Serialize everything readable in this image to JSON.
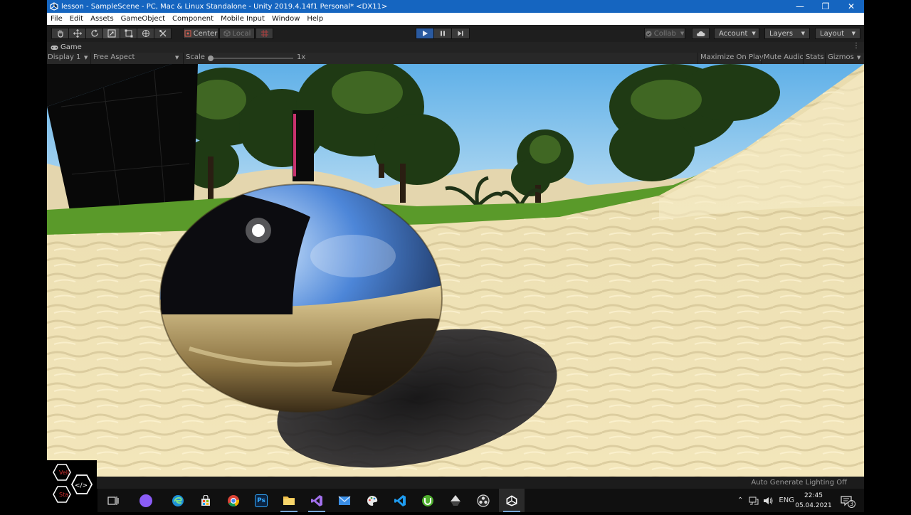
{
  "window": {
    "title": "lesson - SampleScene - PC, Mac & Linux Standalone - Unity 2019.4.14f1 Personal* <DX11>",
    "minimize": "—",
    "maximize": "❐",
    "close": "✕"
  },
  "menu": [
    "File",
    "Edit",
    "Assets",
    "GameObject",
    "Component",
    "Mobile Input",
    "Window",
    "Help"
  ],
  "toolbar": {
    "pivot_label": "Center",
    "space_label": "Local",
    "collab_label": "Collab",
    "account_label": "Account",
    "layers_label": "Layers",
    "layout_label": "Layout"
  },
  "game_tab": {
    "label": "Game",
    "more": "⋮"
  },
  "game_bar": {
    "display": "Display 1",
    "aspect": "Free Aspect",
    "scale_label": "Scale",
    "scale_value": "1x",
    "maximize_on_play": "Maximize On Play",
    "mute_audio": "Mute Audio",
    "stats": "Stats",
    "gizmos": "Gizmos"
  },
  "status": {
    "text": "Auto Generate Lighting Off"
  },
  "taskbar": {
    "lang": "ENG",
    "time": "22:45",
    "date": "05.04.2021",
    "notifications": "3"
  },
  "icon_labels": {
    "photoshop": "Ps"
  },
  "logo": {
    "text_top": "Veli",
    "text_bottom": "Sta"
  },
  "colors": {
    "title_bar": "#1565c0",
    "play_button": "#2a5aa0",
    "sky": "#7cc0ea",
    "sand": "#efe2b4"
  }
}
